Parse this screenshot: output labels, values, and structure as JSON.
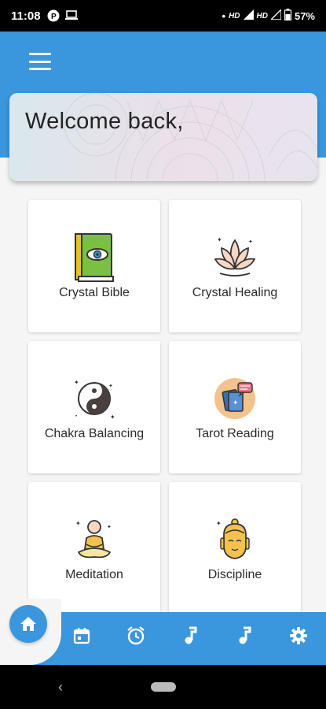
{
  "status_bar": {
    "time": "11:08",
    "network_label_1": "HD",
    "network_label_2": "HD",
    "battery": "57%"
  },
  "header": {
    "menu_icon": "hamburger-menu-icon",
    "welcome": "Welcome back,"
  },
  "tiles": [
    {
      "label": "Crystal Bible",
      "icon": "eye-book-icon"
    },
    {
      "label": "Crystal Healing",
      "icon": "lotus-icon"
    },
    {
      "label": "Chakra Balancing",
      "icon": "yin-yang-icon"
    },
    {
      "label": "Tarot Reading",
      "icon": "tarot-cards-icon"
    },
    {
      "label": "Meditation",
      "icon": "meditating-person-icon"
    },
    {
      "label": "Discipline",
      "icon": "buddha-head-icon"
    }
  ],
  "bottom_nav": {
    "items": [
      "home-icon",
      "calendar-icon",
      "alarm-clock-icon",
      "music-note-icon",
      "music-note-icon",
      "gear-icon"
    ]
  },
  "colors": {
    "primary": "#3a96dd",
    "background": "#f5f5f5"
  }
}
